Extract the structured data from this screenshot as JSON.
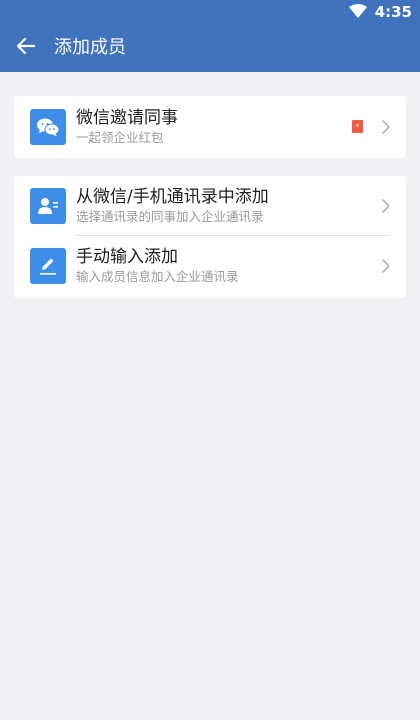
{
  "status_bar": {
    "time": "4:35",
    "wifi_icon": "wifi-icon"
  },
  "app_bar": {
    "back_icon": "arrow-back-icon",
    "title": "添加成员"
  },
  "invite_card": {
    "title": "微信邀请同事",
    "subtitle": "一起领企业红包",
    "icon": "wechat-icon",
    "badge_icon": "red-packet-icon"
  },
  "add_card": {
    "items": [
      {
        "title": "从微信/手机通讯录中添加",
        "subtitle": "选择通讯录的同事加入企业通讯录",
        "icon": "contact-card-icon"
      },
      {
        "title": "手动输入添加",
        "subtitle": "输入成员信息加入企业通讯录",
        "icon": "pencil-icon"
      }
    ]
  },
  "colors": {
    "app_bar": "#3f73be",
    "icon_bg": "#3d8ee8",
    "page_bg": "#f0f1f4",
    "red_packet": "#ef5a4c"
  }
}
